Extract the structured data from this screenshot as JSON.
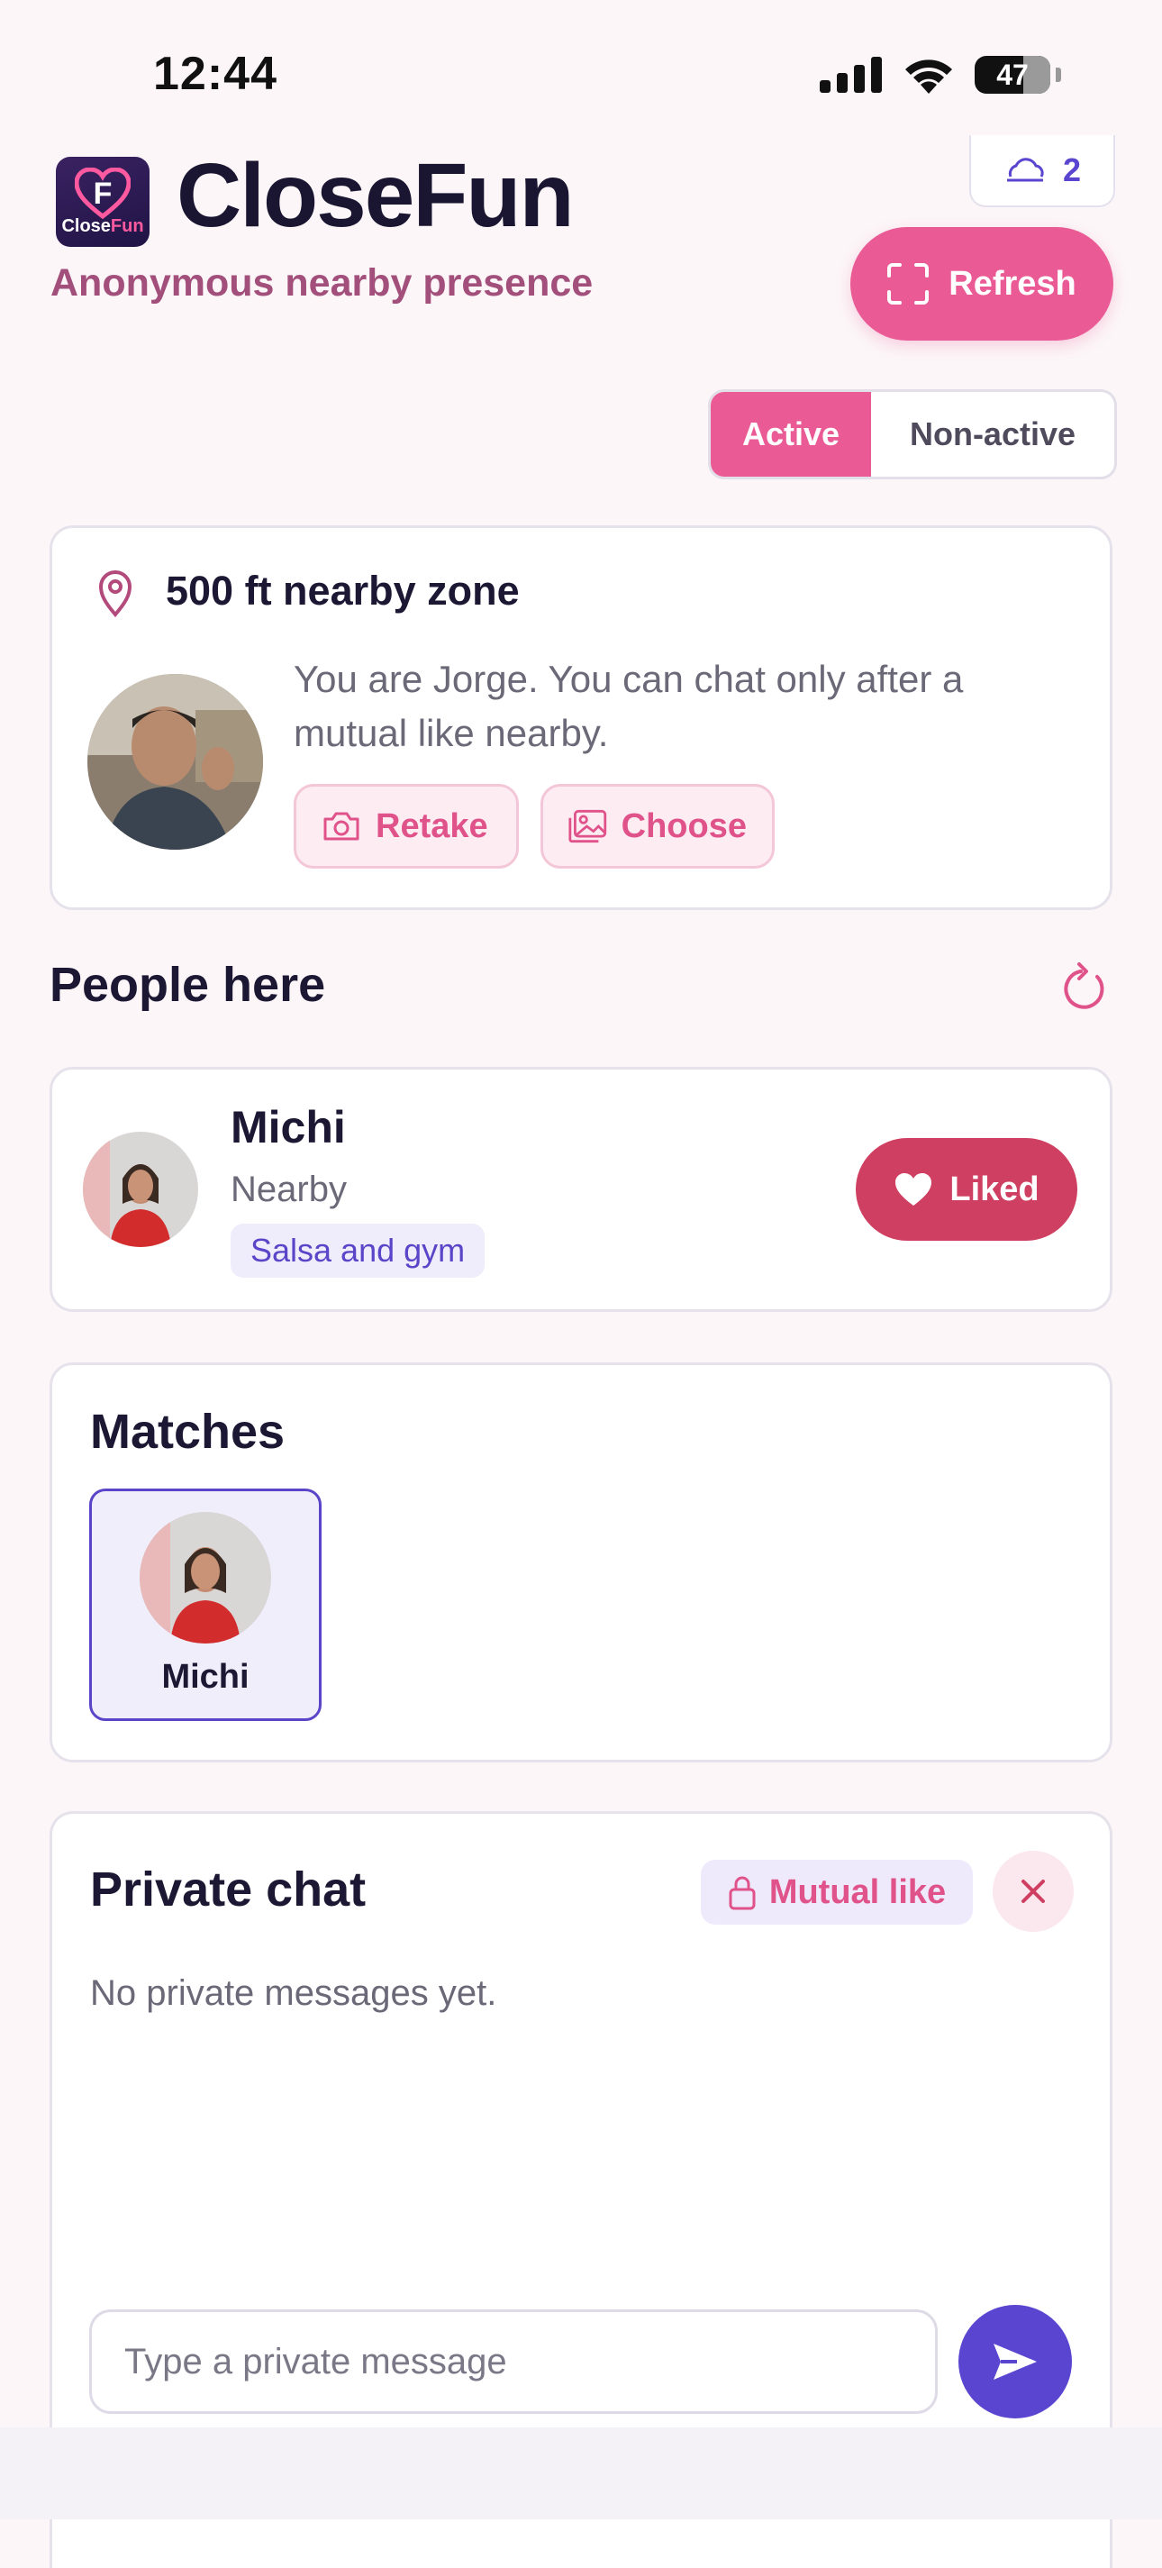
{
  "status_bar": {
    "time": "12:44",
    "battery": "47"
  },
  "header": {
    "app_name": "CloseFun",
    "logo_text_a": "Close",
    "logo_text_b": "Fun",
    "subtitle": "Anonymous nearby presence",
    "top_chip_count": "2",
    "refresh_label": "Refresh"
  },
  "toggle": {
    "active_label": "Active",
    "inactive_label": "Non-active",
    "selected": "Active"
  },
  "zone": {
    "title": "500 ft nearby zone",
    "description": "You are Jorge. You can chat only after a mutual like nearby.",
    "retake_label": "Retake",
    "choose_label": "Choose"
  },
  "people": {
    "title": "People here",
    "items": [
      {
        "name": "Michi",
        "status": "Nearby",
        "tag": "Salsa and gym",
        "action_label": "Liked"
      }
    ]
  },
  "matches": {
    "title": "Matches",
    "items": [
      {
        "name": "Michi"
      }
    ]
  },
  "chat": {
    "title": "Private chat",
    "badge": "Mutual like",
    "empty_text": "No private messages yet.",
    "input_placeholder": "Type a private message"
  },
  "colors": {
    "accent_pink": "#ea5b96",
    "liked_red": "#cf3f61",
    "purple": "#5a45d0",
    "subtitle": "#a24f7c"
  },
  "icons": [
    "signal-icon",
    "wifi-icon",
    "battery-icon",
    "cloud-icon",
    "scan-icon",
    "location-pin-icon",
    "camera-icon",
    "image-icon",
    "refresh-icon",
    "heart-icon",
    "lock-icon",
    "close-icon",
    "send-icon"
  ]
}
